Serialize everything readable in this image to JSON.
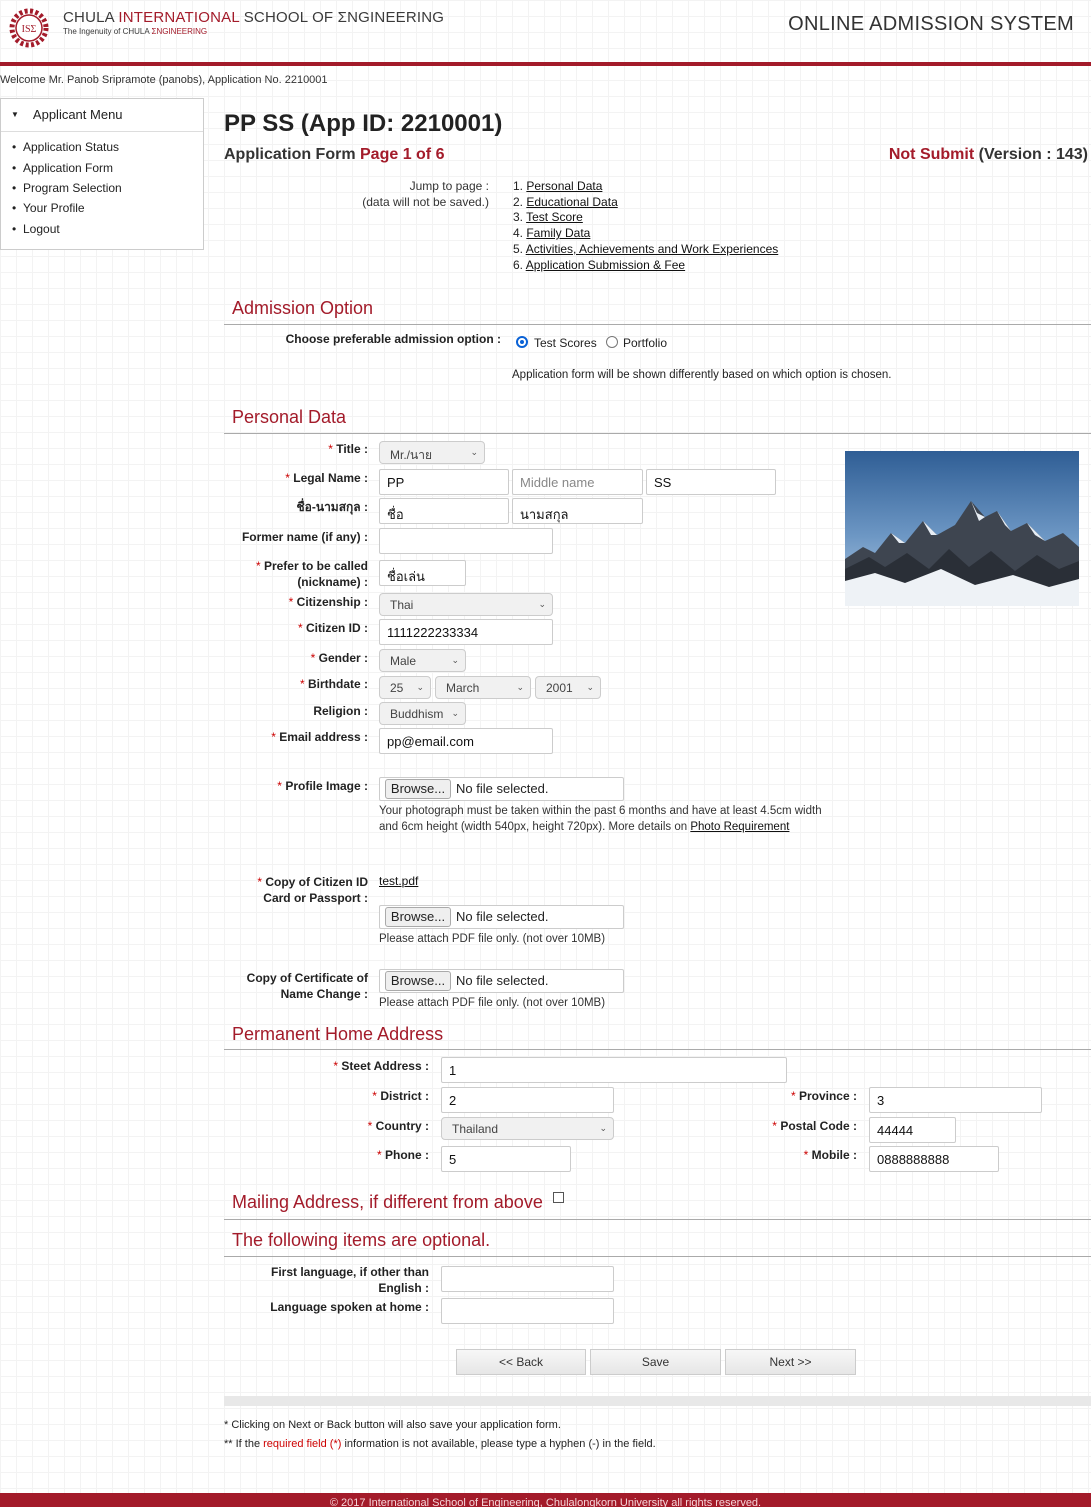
{
  "header": {
    "brand_part1": "CHULA ",
    "brand_part2": "INTERNATIONAL",
    "brand_part3": " SCHOOL OF ΣNGINEERING",
    "tagline_part1": "The Ingenuity of CHULA ",
    "tagline_part2": "ΣNGINEERING",
    "logo_text": "ISΣ",
    "system_title": "ONLINE ADMISSION SYSTEM"
  },
  "welcome": "Welcome Mr. Panob Sripramote (panobs), Application No. 2210001",
  "sidebar": {
    "heading": "Applicant Menu",
    "items": [
      {
        "label": "Application Status"
      },
      {
        "label": "Application Form"
      },
      {
        "label": "Program Selection"
      },
      {
        "label": "Your Profile"
      },
      {
        "label": "Logout"
      }
    ]
  },
  "page_title": "PP SS (App ID: 2210001)",
  "form_page": {
    "prefix": "Application Form ",
    "page": "Page 1 of 6"
  },
  "status": {
    "state": "Not Submit",
    "version": " (Version : 143)"
  },
  "jump": {
    "label": "Jump to page :",
    "note": "(data will not be saved.)",
    "pages": [
      {
        "num": "1. ",
        "label": "Personal Data"
      },
      {
        "num": "2. ",
        "label": "Educational Data"
      },
      {
        "num": "3. ",
        "label": "Test Score"
      },
      {
        "num": "4. ",
        "label": "Family Data"
      },
      {
        "num": "5. ",
        "label": "Activities, Achievements and Work Experiences"
      },
      {
        "num": "6. ",
        "label": "Application Submission & Fee"
      }
    ]
  },
  "admission": {
    "section_title": "Admission Option",
    "label": "Choose preferable admission option :",
    "options": [
      "Test Scores",
      "Portfolio"
    ],
    "selected": "Test Scores",
    "note": "Application form will be shown differently based on which option is chosen."
  },
  "personal": {
    "section_title": "Personal Data",
    "title_label": "Title :",
    "title_value": "Mr./นาย",
    "legal_name_label": "Legal Name :",
    "first_name": "PP",
    "middle_name_placeholder": "Middle name",
    "last_name": "SS",
    "thai_name_label": "ชื่อ-นามสกุล :",
    "thai_first": "ชื่อ",
    "thai_last": "นามสกุล",
    "former_name_label": "Former name (if any) :",
    "former_name_value": "",
    "nickname_label_1": "Prefer to be called",
    "nickname_label_2": "(nickname) :",
    "nickname_value": "ชื่อเล่น",
    "citizenship_label": "Citizenship :",
    "citizenship_value": "Thai",
    "citizen_id_label": "Citizen ID :",
    "citizen_id_value": "1111222233334",
    "gender_label": "Gender :",
    "gender_value": "Male",
    "birthdate_label": "Birthdate :",
    "birth_day": "25",
    "birth_month": "March",
    "birth_year": "2001",
    "religion_label": "Religion :",
    "religion_value": "Buddhism",
    "email_label": "Email address :",
    "email_value": "pp@email.com",
    "profile_image_label": "Profile Image :",
    "browse_label": "Browse...",
    "no_file": "No file selected.",
    "photo_note": "Your photograph must be taken within the past 6 months and have at least 4.5cm width and 6cm height (width 540px, height 720px). More details on ",
    "photo_link": "Photo Requirement",
    "citizen_copy_label_1": "Copy of Citizen ID",
    "citizen_copy_label_2": "Card or Passport :",
    "citizen_copy_file": "test.pdf",
    "pdf_note": "Please attach PDF file only. (not over 10MB)",
    "name_change_label_1": "Copy of Certificate of",
    "name_change_label_2": "Name Change :"
  },
  "address": {
    "section_title": "Permanent Home Address",
    "street_label": "Steet Address :",
    "street_value": "1",
    "district_label": "District :",
    "district_value": "2",
    "province_label": "Province :",
    "province_value": "3",
    "country_label": "Country :",
    "country_value": "Thailand",
    "postal_label": "Postal Code :",
    "postal_value": "44444",
    "phone_label": "Phone :",
    "phone_value": "5",
    "mobile_label": "Mobile :",
    "mobile_value": "0888888888"
  },
  "mailing": {
    "section_title": "Mailing Address, if different from above",
    "checked": false
  },
  "optional": {
    "section_title": "The following items are optional.",
    "first_lang_label_1": "First language, if other than",
    "first_lang_label_2": "English :",
    "first_lang_value": "",
    "home_lang_label": "Language spoken at home :",
    "home_lang_value": ""
  },
  "buttons": {
    "back": "<< Back",
    "save": "Save",
    "next": "Next >>"
  },
  "footnotes": {
    "line1": "* Clicking on Next or Back button will also save your application form.",
    "line2_prefix": "** If the ",
    "line2_required": "required field (*)",
    "line2_suffix": " information is not available, please type a hyphen (-) in the field."
  },
  "footer": "© 2017 International School of Engineering, Chulalongkorn University all rights reserved.",
  "colors": {
    "brand_red": "#a31b2a",
    "required_red": "#cc0000",
    "radio_blue": "#0a62d6"
  }
}
